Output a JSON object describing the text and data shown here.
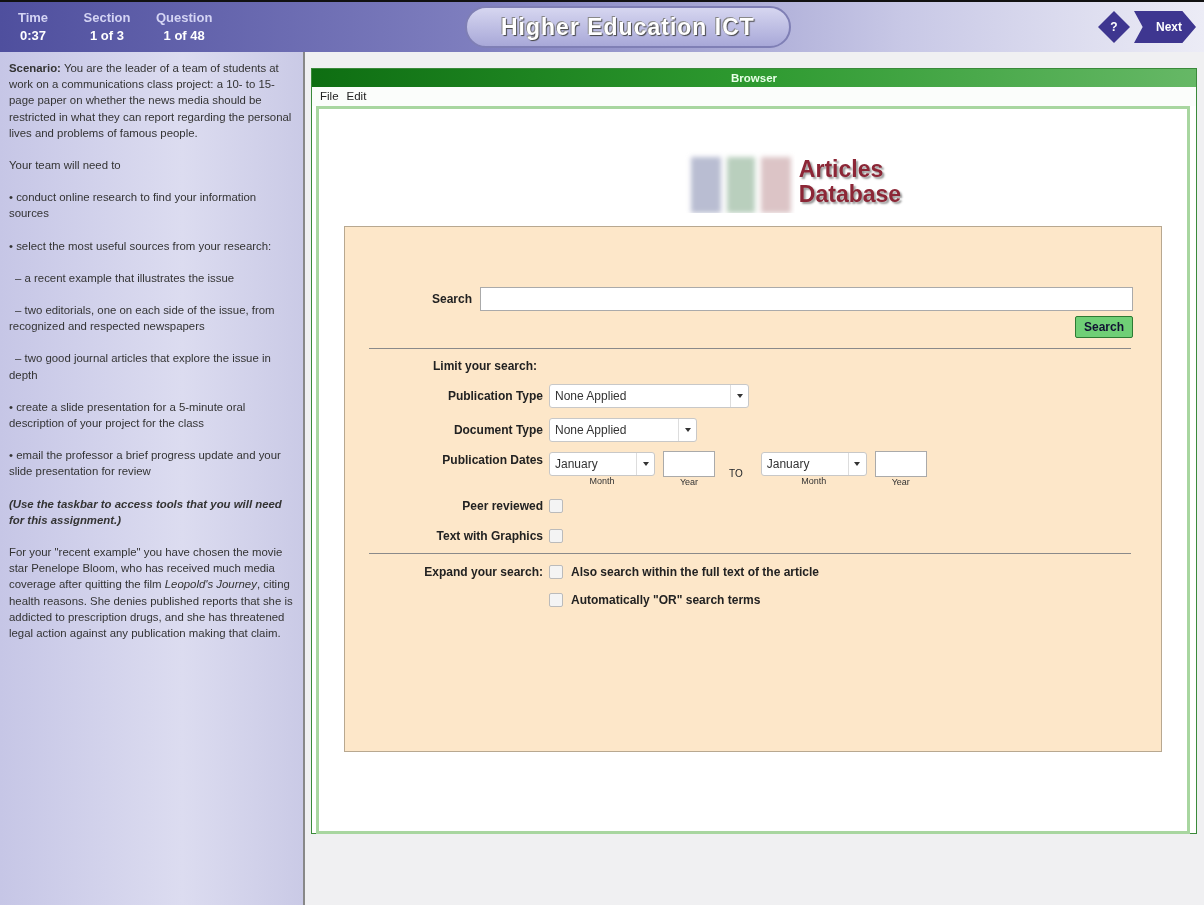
{
  "header": {
    "stats": [
      {
        "label": "Time",
        "value": "0:37"
      },
      {
        "label": "Section",
        "value": "1 of 3"
      },
      {
        "label": "Question",
        "value": "1 of 48"
      }
    ],
    "title": "Higher Education ICT",
    "help_button": "?",
    "next_button": "Next"
  },
  "sidebar": {
    "intro": "**Scenario:** You are the leader of a team of students at work on a communications class project: a 10- to 15-page paper on whether the news media should be restricted in what they can report regarding the personal lives and problems of famous people.",
    "tasks_heading": "Your team will need to",
    "tasks": [
      {
        "kind": "bullet",
        "text": "• conduct online research to find your information sources"
      },
      {
        "kind": "bullet",
        "text": "• select the most useful sources from your research:"
      },
      {
        "kind": "sub",
        "text": "– a recent example that illustrates the issue"
      },
      {
        "kind": "sub",
        "text": "– two editorials, one on each side of the issue, from recognized and respected newspapers"
      },
      {
        "kind": "sub",
        "text": "– two good journal articles that explore the issue in depth"
      },
      {
        "kind": "bullet",
        "text": "• create a slide presentation for a 5-minute oral description of your project for the class"
      },
      {
        "kind": "bullet",
        "text": "• email the professor a brief progress update and your slide presentation for review"
      }
    ],
    "note": "(Use the taskbar to access tools that you will need for this assignment.)",
    "example": "For your \"recent example\" you have chosen the movie star Penelope Bloom, who has received much media coverage after quitting the film *Leopold's Journey*, citing health reasons. She denies published reports that she is addicted to prescription drugs, and she has threatened legal action against any publication making that claim."
  },
  "browser": {
    "title": "Browser",
    "menu": [
      "File",
      "Edit"
    ],
    "logo": [
      "Articles",
      "Database"
    ],
    "search": {
      "label": "Search",
      "button": "Search"
    },
    "limit": {
      "heading": "Limit your search:",
      "rows": [
        {
          "kind": "select",
          "label": "Publication Type",
          "value": "None Applied"
        },
        {
          "kind": "select",
          "label": "Document Type",
          "value": "None Applied"
        },
        {
          "kind": "dates",
          "label": "Publication Dates",
          "from": {
            "month": "January",
            "month_caption": "Month",
            "year_caption": "Year"
          },
          "separator": "TO",
          "to": {
            "month": "January",
            "month_caption": "Month",
            "year_caption": "Year"
          }
        },
        {
          "kind": "checkbox",
          "label": "Peer reviewed",
          "checked": false
        },
        {
          "kind": "checkbox",
          "label": "Text with Graphics",
          "checked": false
        }
      ]
    },
    "expand": {
      "label": "Expand your search:",
      "options": [
        {
          "label": "Also search within the full text of the article",
          "checked": false
        },
        {
          "label": "Automatically \"OR\" search terms",
          "checked": false
        }
      ]
    }
  }
}
